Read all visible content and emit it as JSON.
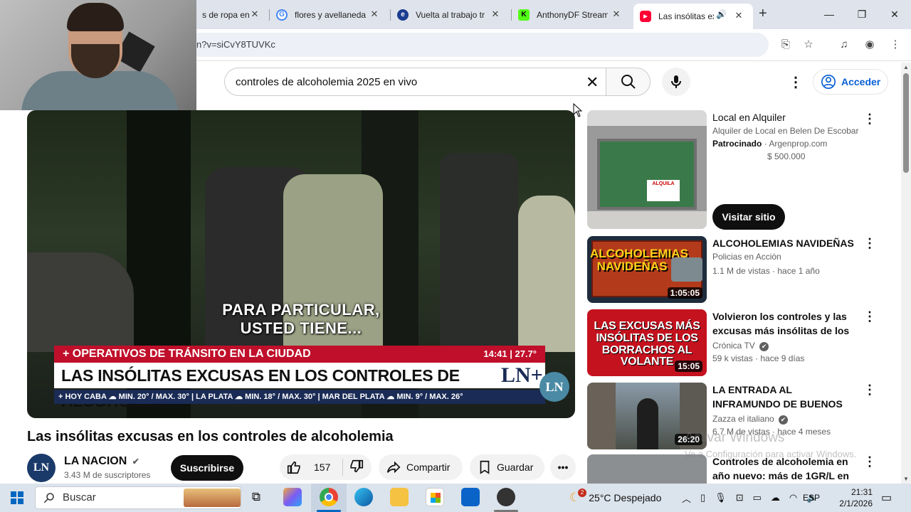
{
  "browser": {
    "tabs": [
      {
        "title": "s de ropa en",
        "active": false
      },
      {
        "title": "flores y avellaneda",
        "active": false
      },
      {
        "title": "Vuelta al trabajo tr",
        "active": false
      },
      {
        "title": "AnthonyDF Stream",
        "active": false
      },
      {
        "title": "Las insólitas ex",
        "active": true
      }
    ],
    "new_tab": "+",
    "url": "n?v=siCvY8TUVKc"
  },
  "youtube": {
    "search_query": "controles de alcoholemia 2025 en vivo",
    "sign_in": "Acceder"
  },
  "video": {
    "subtitle_line1": "PARA PARTICULAR,",
    "subtitle_line2": "USTED TIENE...",
    "banner_top": "+ OPERATIVOS DE TRÁNSITO EN LA CIUDAD",
    "banner_time": "14:41 | 27.7°",
    "banner_main": "LAS INSÓLITAS EXCUSAS EN LOS CONTROLES DE ALCOHOLEMIA",
    "banner_logo": "LN+",
    "ticker": "+ HOY   CABA ☁ MIN. 20° / MAX. 30°  |  LA PLATA ☁ MIN. 18° / MAX. 30°  |  MAR DEL PLATA ☁ MIN. 9° / MAX. 26°",
    "bug": "LN",
    "title": "Las insólitas excusas en los controles de alcoholemia",
    "channel": "LA NACION",
    "channel_avatar": "LN",
    "subscribers": "3.43 M de suscriptores",
    "subscribe_label": "Suscribirse",
    "likes": "157",
    "share_label": "Compartir",
    "save_label": "Guardar"
  },
  "sidebar": {
    "ad": {
      "title": "Local en Alquiler",
      "description": "Alquiler de Local en Belen De Escobar",
      "sponsored": "Patrocinado",
      "domain": "Argenprop.com",
      "price": "$ 500.000",
      "cta": "Visitar sitio",
      "sign_text": "ALQUILA"
    },
    "videos": [
      {
        "title": "ALCOHOLEMIAS NAVIDEÑAS",
        "channel": "Policias en Acción",
        "verified": false,
        "meta": "1.1 M de vistas · hace 1 año",
        "duration": "1:05:05",
        "thumb_text": "ALCOHOLEMIAS NAVIDEÑAS"
      },
      {
        "title": "Volvieron los controles y las excusas más insólitas de los ...",
        "channel": "Crónica TV",
        "verified": true,
        "meta": "59 k vistas · hace 9 días",
        "duration": "15:05",
        "thumb_text": "LAS EXCUSAS MÁS INSÓLITAS DE LOS BORRACHOS AL VOLANTE"
      },
      {
        "title": "LA ENTRADA AL INFRAMUNDO DE BUENOS AIRES - ¡Aquí NO ...",
        "channel": "Zazza el italiano",
        "verified": true,
        "meta": "6.7 M de vistas · hace 4 meses",
        "duration": "26:20",
        "thumb_text": ""
      },
      {
        "title": "Controles de alcoholemia en año nuevo: más de 1GR/L en ...",
        "channel": "",
        "verified": false,
        "meta": "",
        "duration": "",
        "thumb_text": ""
      }
    ]
  },
  "watermark": {
    "line1": "Activar Windows",
    "line2": "Ve a Configuración para activar Windows."
  },
  "taskbar": {
    "search_placeholder": "Buscar",
    "weather": "25°C  Despejado",
    "weather_badge": "2",
    "language": "ESP",
    "time": "21:31",
    "date": "2/1/2026"
  }
}
